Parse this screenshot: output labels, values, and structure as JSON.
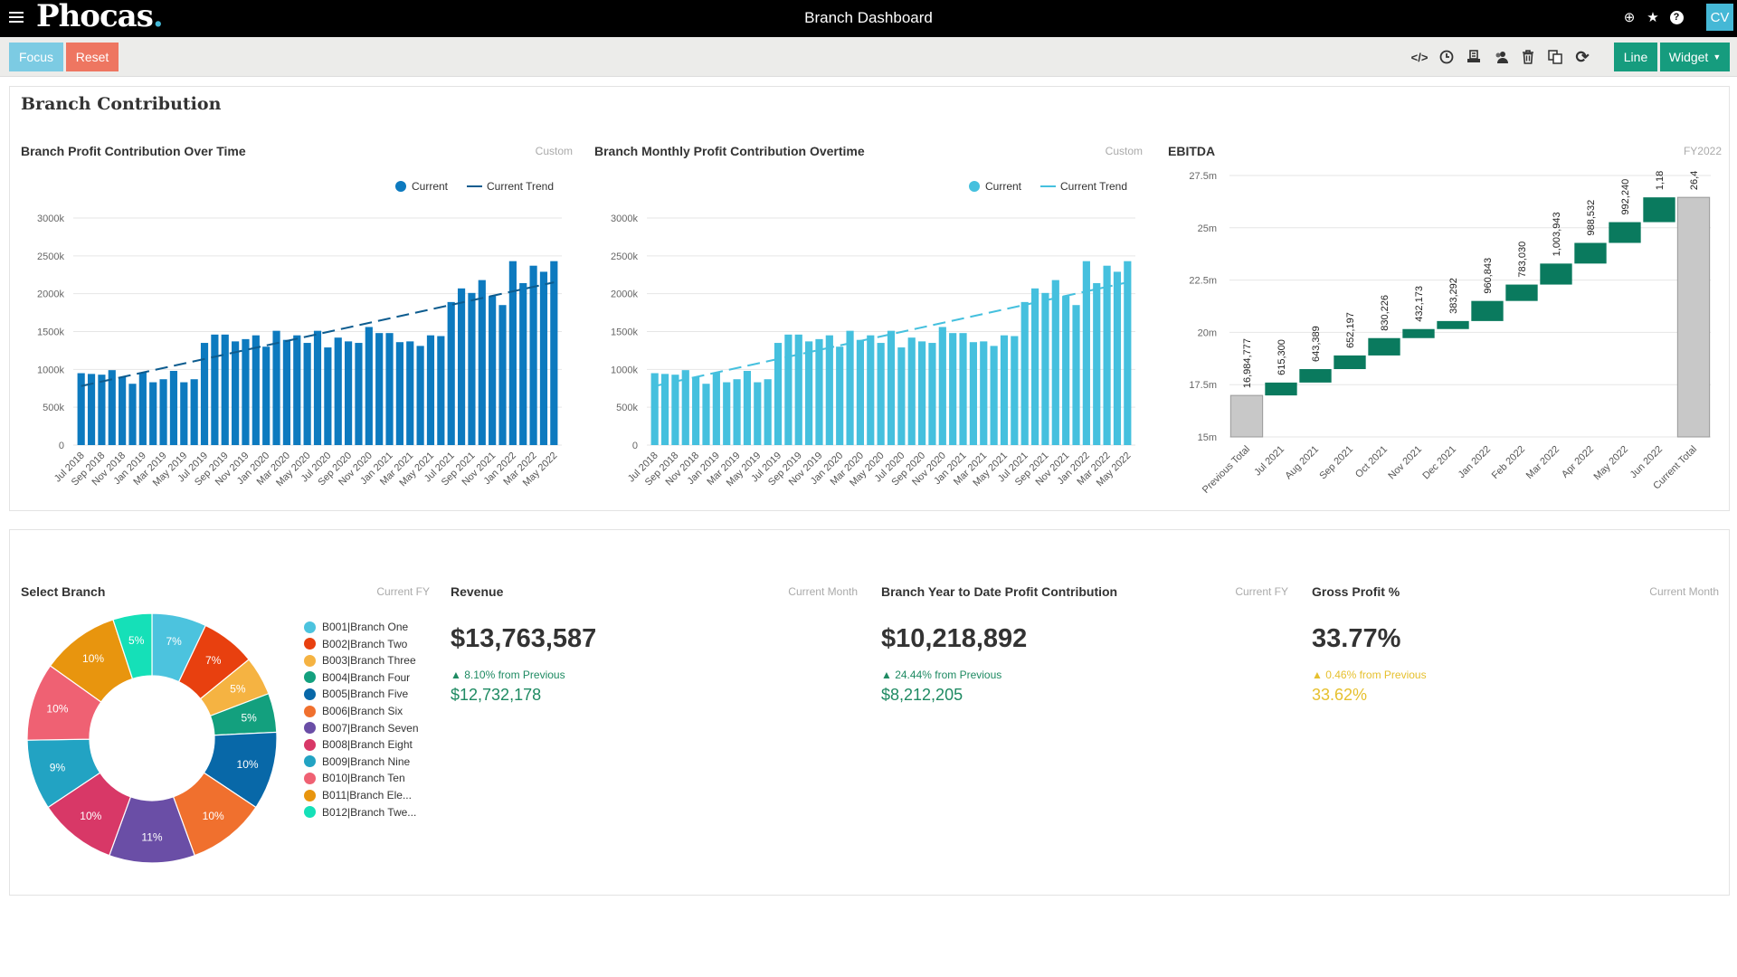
{
  "app": {
    "logo": "Phocas",
    "logo_dot": ".",
    "title": "Branch Dashboard",
    "user_initials": "CV"
  },
  "topbar_icons": [
    "plus-circle-icon",
    "star-icon",
    "help-icon"
  ],
  "toolbar": {
    "focus_label": "Focus",
    "reset_label": "Reset",
    "line_label": "Line",
    "widget_label": "Widget",
    "tools": [
      "code-icon",
      "clock-icon",
      "print-icon",
      "users-icon",
      "trash-icon",
      "copy-icon",
      "refresh-icon"
    ]
  },
  "colors": {
    "focus": "#7ccbe3",
    "reset": "#ee7661",
    "accent": "#169c7e",
    "bar_dark": "#0d7abf",
    "bar_light": "#45c0de",
    "waterfall_up": "#0a7a5e",
    "waterfall_total": "#c8c8c8",
    "positive": "#1e8a62",
    "warning": "#e6c02e"
  },
  "section1": {
    "title": "Branch Contribution"
  },
  "section2": {
    "title": ""
  },
  "chart_data": [
    {
      "id": "profit-over-time",
      "type": "bar",
      "title": "Branch Profit Contribution Over Time",
      "subtitle": "Custom",
      "legend": [
        "Current",
        "Current Trend"
      ],
      "legend_position": "top-right",
      "ylim": [
        0,
        3000
      ],
      "yticks": [
        "0",
        "500k",
        "1000k",
        "1500k",
        "2000k",
        "2500k",
        "3000k"
      ],
      "ytick_values": [
        0,
        500,
        1000,
        1500,
        2000,
        2500,
        3000
      ],
      "xlabels_shown": [
        "Jul 2018",
        "Sep 2018",
        "Nov 2018",
        "Jan 2019",
        "Mar 2019",
        "May 2019",
        "Jul 2019",
        "Sep 2019",
        "Nov 2019",
        "Jan 2020",
        "Mar 2020",
        "May 2020",
        "Jul 2020",
        "Sep 2020",
        "Nov 2020",
        "Jan 2021",
        "Mar 2021",
        "May 2021",
        "Jul 2021",
        "Sep 2021",
        "Nov 2021",
        "Jan 2022",
        "Mar 2022",
        "May 2022"
      ],
      "values_k": [
        950,
        940,
        930,
        990,
        900,
        810,
        960,
        830,
        870,
        980,
        830,
        870,
        1350,
        1460,
        1460,
        1370,
        1400,
        1450,
        1300,
        1510,
        1390,
        1450,
        1350,
        1510,
        1290,
        1420,
        1370,
        1350,
        1560,
        1480,
        1480,
        1360,
        1370,
        1310,
        1450,
        1440,
        1890,
        2070,
        2010,
        2180,
        1970,
        1850,
        2430,
        2140,
        2370,
        2290,
        2430
      ],
      "trend_k": [
        780,
        2150
      ],
      "grid": true
    },
    {
      "id": "monthly-profit",
      "type": "bar",
      "title": "Branch Monthly Profit Contribution Overtime",
      "subtitle": "Custom",
      "legend": [
        "Current",
        "Current Trend"
      ],
      "legend_position": "top-right",
      "ylim": [
        0,
        3000
      ],
      "yticks": [
        "0",
        "500k",
        "1000k",
        "1500k",
        "2000k",
        "2500k",
        "3000k"
      ],
      "ytick_values": [
        0,
        500,
        1000,
        1500,
        2000,
        2500,
        3000
      ],
      "xlabels_shown": [
        "Jul 2018",
        "Sep 2018",
        "Nov 2018",
        "Jan 2019",
        "Mar 2019",
        "May 2019",
        "Jul 2019",
        "Sep 2019",
        "Nov 2019",
        "Jan 2020",
        "Mar 2020",
        "May 2020",
        "Jul 2020",
        "Sep 2020",
        "Nov 2020",
        "Jan 2021",
        "Mar 2021",
        "May 2021",
        "Jul 2021",
        "Sep 2021",
        "Nov 2021",
        "Jan 2022",
        "Mar 2022",
        "May 2022"
      ],
      "values_k": [
        950,
        940,
        930,
        990,
        900,
        810,
        960,
        830,
        870,
        980,
        830,
        870,
        1350,
        1460,
        1460,
        1370,
        1400,
        1450,
        1300,
        1510,
        1390,
        1450,
        1350,
        1510,
        1290,
        1420,
        1370,
        1350,
        1560,
        1480,
        1480,
        1360,
        1370,
        1310,
        1450,
        1440,
        1890,
        2070,
        2010,
        2180,
        1970,
        1850,
        2430,
        2140,
        2370,
        2290,
        2430
      ],
      "trend_k": [
        780,
        2150
      ],
      "grid": true
    },
    {
      "id": "ebitda",
      "type": "bar",
      "subtype": "waterfall",
      "title": "EBITDA",
      "subtitle": "FY2022",
      "ylim": [
        15,
        27.5
      ],
      "yticks": [
        "15m",
        "17.5m",
        "20m",
        "22.5m",
        "25m",
        "27.5m"
      ],
      "ytick_values": [
        15,
        17.5,
        20,
        22.5,
        25,
        27.5
      ],
      "categories": [
        "Previous Total",
        "Jul 2021",
        "Aug 2021",
        "Sep 2021",
        "Oct 2021",
        "Nov 2021",
        "Dec 2021",
        "Jan 2022",
        "Feb 2022",
        "Mar 2022",
        "Apr 2022",
        "May 2022",
        "Jun 2022",
        "Current Total"
      ],
      "values": [
        16984777,
        615300,
        643389,
        652197,
        830226,
        432173,
        383292,
        960843,
        783030,
        1003943,
        988532,
        992240,
        1185000,
        26455000
      ],
      "labels": [
        "16,984,777",
        "615,300",
        "643,389",
        "652,197",
        "830,226",
        "432,173",
        "383,292",
        "960,843",
        "783,030",
        "1,003,943",
        "988,532",
        "992,240",
        "1,18",
        "26,4"
      ],
      "grid": true
    },
    {
      "id": "select-branch",
      "type": "pie",
      "subtype": "donut",
      "title": "Select Branch",
      "subtitle": "Current FY",
      "legend_position": "right",
      "slices": [
        {
          "label": "B001|Branch One",
          "value": 7,
          "color": "#4cc3de"
        },
        {
          "label": "B002|Branch Two",
          "value": 7,
          "color": "#e8400f"
        },
        {
          "label": "B003|Branch Three",
          "value": 5,
          "color": "#f5b342"
        },
        {
          "label": "B004|Branch Four",
          "value": 5,
          "color": "#13a07e"
        },
        {
          "label": "B005|Branch Five",
          "value": 10,
          "color": "#0868a8"
        },
        {
          "label": "B006|Branch Six",
          "value": 10,
          "color": "#f0702e"
        },
        {
          "label": "B007|Branch Seven",
          "value": 11,
          "color": "#6a4ea6"
        },
        {
          "label": "B008|Branch Eight",
          "value": 10,
          "color": "#d83867"
        },
        {
          "label": "B009|Branch Nine",
          "value": 9,
          "color": "#22a3c3"
        },
        {
          "label": "B010|Branch Ten",
          "value": 10,
          "color": "#ef6173"
        },
        {
          "label": "B011|Branch Ele...",
          "value": 10,
          "color": "#e8950e"
        },
        {
          "label": "B012|Branch Twe...",
          "value": 5,
          "color": "#15e0b8"
        }
      ]
    }
  ],
  "kpis": [
    {
      "title": "Revenue",
      "period": "Current Month",
      "value": "$13,763,587",
      "change": "▲ 8.10% from Previous",
      "previous": "$12,732,178",
      "status": "positive"
    },
    {
      "title": "Branch Year to Date Profit Contribution",
      "period": "Current FY",
      "value": "$10,218,892",
      "change": "▲ 24.44% from Previous",
      "previous": "$8,212,205",
      "status": "positive"
    },
    {
      "title": "Gross Profit %",
      "period": "Current Month",
      "value": "33.77%",
      "change": "▲ 0.46% from Previous",
      "previous": "33.62%",
      "status": "warning"
    }
  ]
}
